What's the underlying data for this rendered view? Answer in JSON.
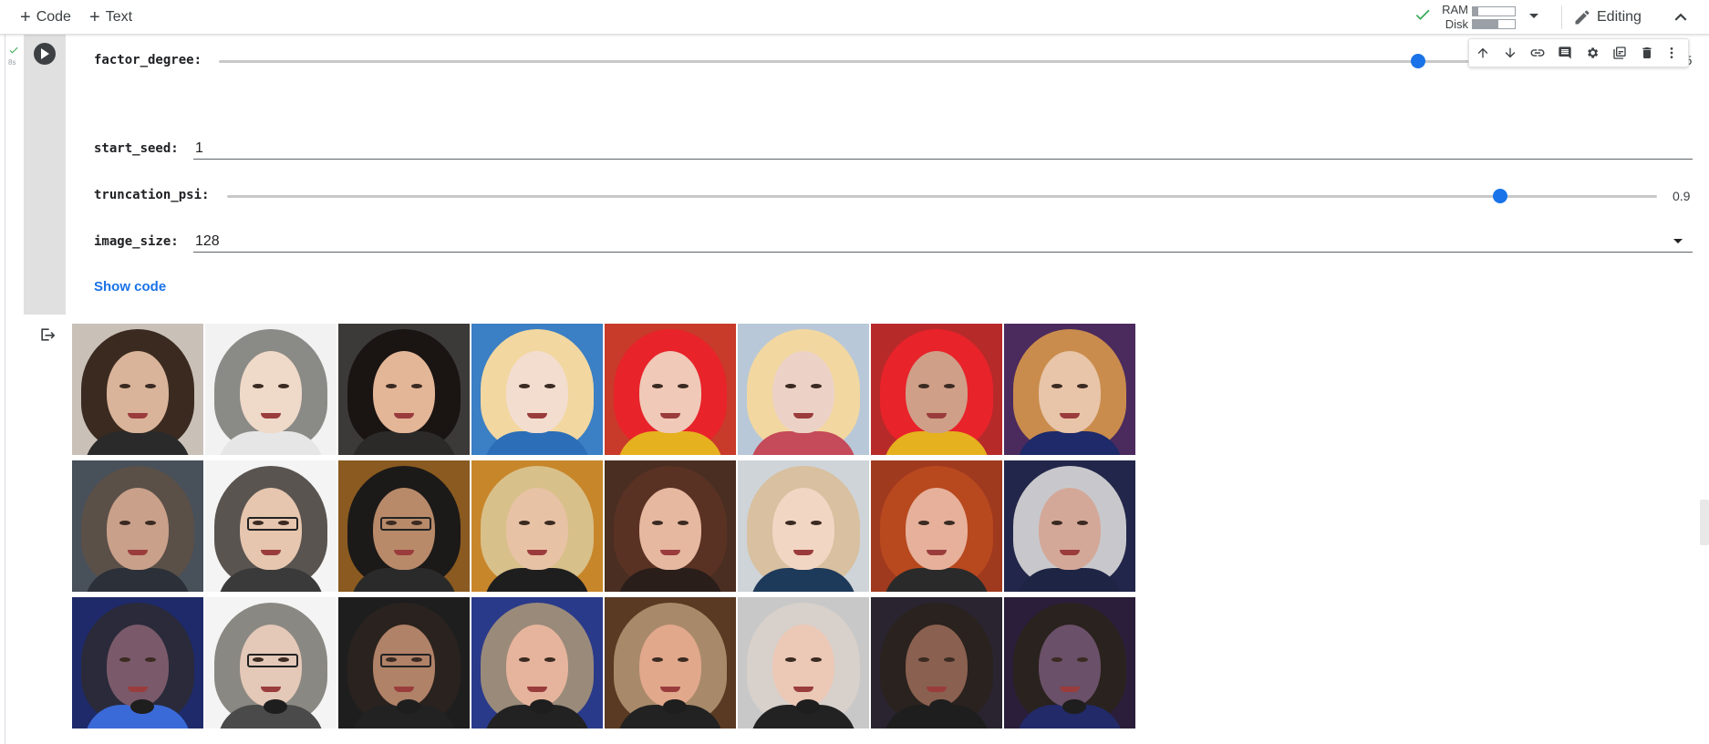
{
  "toolbar": {
    "code_label": "Code",
    "text_label": "Text",
    "ram_label": "RAM",
    "disk_label": "Disk",
    "ram_usage": 0.12,
    "disk_usage": 0.6,
    "editing_label": "Editing",
    "status_color": "#34a853"
  },
  "cell": {
    "exec_time": "8s",
    "fields": {
      "factor_degree": {
        "label": "factor_degree:",
        "value": "5.5",
        "fraction": 0.83
      },
      "start_seed": {
        "label": "start_seed:",
        "value": "1"
      },
      "truncation_psi": {
        "label": "truncation_psi:",
        "value": "0.9",
        "fraction": 0.89
      },
      "image_size": {
        "label": "image_size:",
        "value": "128"
      }
    },
    "show_code_label": "Show code",
    "accent_color": "#1a73e8"
  },
  "cell_toolbar_icons": [
    "arrow-up-icon",
    "arrow-down-icon",
    "link-icon",
    "comment-icon",
    "gear-icon",
    "mirror-cell-icon",
    "trash-icon",
    "more-vert-icon"
  ],
  "output": {
    "grid_rows": 3,
    "grid_cols": 8,
    "faces": [
      {
        "hair": "#3b2a20",
        "skin": "#d9b49a",
        "bg": "#c9c1b8",
        "body": "#2a2a2a"
      },
      {
        "hair": "#8a8a86",
        "skin": "#efd9c8",
        "bg": "#f2f2f2",
        "body": "#e6e6e6"
      },
      {
        "hair": "#1a1412",
        "skin": "#e3b697",
        "bg": "#3c3a38",
        "body": "#2c2a28"
      },
      {
        "hair": "#f2d7a0",
        "skin": "#f3ddcf",
        "bg": "#3b7fc4",
        "body": "#2c6eb8"
      },
      {
        "hair": "#e8232a",
        "skin": "#f0c9b8",
        "bg": "#c83a2a",
        "body": "#e6b11e"
      },
      {
        "hair": "#f2d7a0",
        "skin": "#ecd2c6",
        "bg": "#b8c8d8",
        "body": "#c54a5a"
      },
      {
        "hair": "#e8232a",
        "skin": "#cf9f88",
        "bg": "#b72a2a",
        "body": "#e6b11e"
      },
      {
        "hair": "#c98c4c",
        "skin": "#e8c4a8",
        "bg": "#4b2a5e",
        "body": "#1e2a6a"
      },
      {
        "hair": "#5a5048",
        "skin": "#c9a08a",
        "bg": "#48505a",
        "body": "#2c3038"
      },
      {
        "hair": "#5a5450",
        "skin": "#e6c6ae",
        "bg": "#f4f4f4",
        "body": "#3a3a3a"
      },
      {
        "hair": "#1c1a18",
        "skin": "#b88a6a",
        "bg": "#8a5a20",
        "body": "#2a2a2a"
      },
      {
        "hair": "#d8c08a",
        "skin": "#e8c2a4",
        "bg": "#c8862a",
        "body": "#1e1e1e"
      },
      {
        "hair": "#5a3224",
        "skin": "#e6b8a0",
        "bg": "#4a2e22",
        "body": "#2a1e1a"
      },
      {
        "hair": "#d8c0a0",
        "skin": "#f2d6c4",
        "bg": "#cfd4d8",
        "body": "#1e3a5a"
      },
      {
        "hair": "#b8481e",
        "skin": "#e6b09a",
        "bg": "#a03a1e",
        "body": "#2a2a2a"
      },
      {
        "hair": "#c8c8cc",
        "skin": "#d4a898",
        "bg": "#22264a",
        "body": "#1e2444"
      },
      {
        "hair": "#2a2a3a",
        "skin": "#7a5a6a",
        "bg": "#1e2a6a",
        "body": "#3a6ad8"
      },
      {
        "hair": "#8a8882",
        "skin": "#e4c8b8",
        "bg": "#f4f4f4",
        "body": "#4a4a4a"
      },
      {
        "hair": "#2a221e",
        "skin": "#b08268",
        "bg": "#1e1e1e",
        "body": "#222222"
      },
      {
        "hair": "#9a8a7a",
        "skin": "#e6b49c",
        "bg": "#2a3a8a",
        "body": "#222222"
      },
      {
        "hair": "#a88a6a",
        "skin": "#e2a88c",
        "bg": "#5a3a22",
        "body": "#222222"
      },
      {
        "hair": "#d8d0ca",
        "skin": "#ecc8b6",
        "bg": "#c8c8c8",
        "body": "#222222"
      },
      {
        "hair": "#2a221e",
        "skin": "#8a6050",
        "bg": "#2a2430",
        "body": "#1e1e1e"
      },
      {
        "hair": "#2a221e",
        "skin": "#6a5068",
        "bg": "#2a1e3a",
        "body": "#222a6a"
      }
    ]
  }
}
